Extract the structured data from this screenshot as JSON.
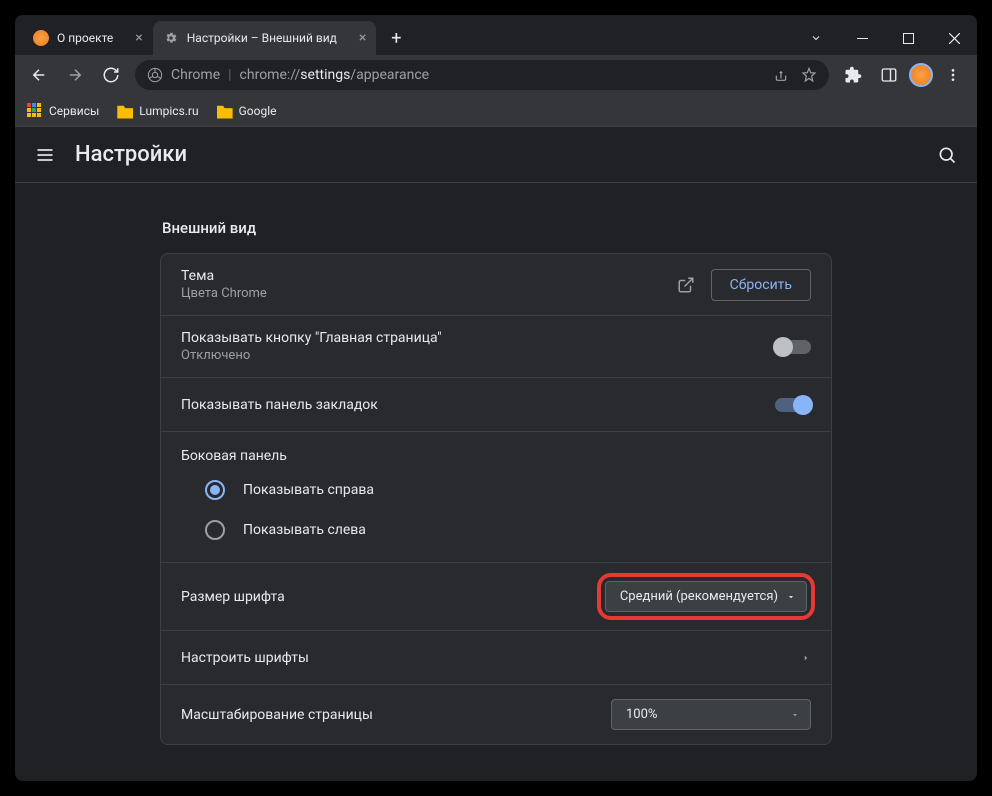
{
  "tabs": [
    {
      "title": "О проекте",
      "active": false
    },
    {
      "title": "Настройки – Внешний вид",
      "active": true
    }
  ],
  "address": {
    "prefix": "Chrome",
    "url_dim1": "chrome://",
    "url_hl": "settings",
    "url_dim2": "/appearance"
  },
  "bookmarks": [
    {
      "label": "Сервисы"
    },
    {
      "label": "Lumpics.ru"
    },
    {
      "label": "Google"
    }
  ],
  "header": {
    "title": "Настройки"
  },
  "section": {
    "title": "Внешний вид",
    "theme": {
      "title": "Тема",
      "sub": "Цвета Chrome",
      "reset": "Сбросить"
    },
    "home_button": {
      "title": "Показывать кнопку \"Главная страница\"",
      "sub": "Отключено"
    },
    "bookmarks_bar": {
      "title": "Показывать панель закладок"
    },
    "side_panel": {
      "title": "Боковая панель",
      "right": "Показывать справа",
      "left": "Показывать слева"
    },
    "font_size": {
      "title": "Размер шрифта",
      "value": "Средний (рекомендуется)"
    },
    "customize_fonts": {
      "title": "Настроить шрифты"
    },
    "zoom": {
      "title": "Масштабирование страницы",
      "value": "100%"
    }
  }
}
